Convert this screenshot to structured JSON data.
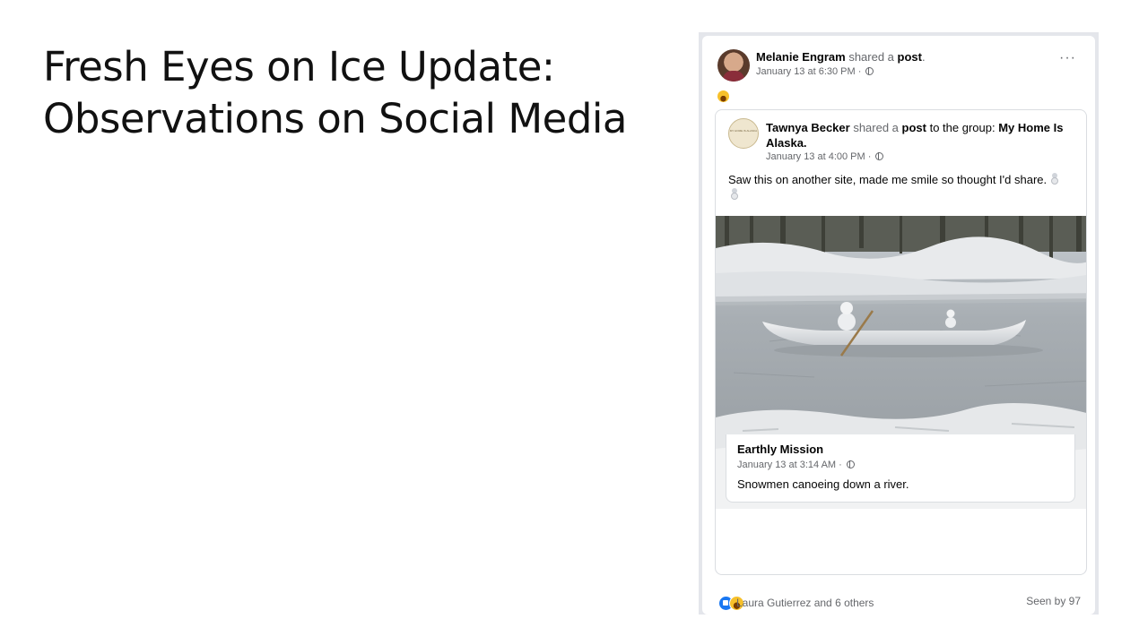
{
  "slide": {
    "title_line1": "Fresh Eyes on Ice Update:",
    "title_line2": "Observations on Social Media"
  },
  "post": {
    "poster_name": "Melanie Engram",
    "poster_action": " shared a ",
    "poster_object": "post",
    "poster_suffix": ".",
    "timestamp": "January 13 at 6:30 PM · ",
    "more_label": "···",
    "reaction_emoji": "laughing-emoji"
  },
  "shared_post": {
    "poster_name": "Tawnya Becker",
    "action1": " shared a ",
    "object": "post",
    "action2": " to the group: ",
    "group_name": "My Home Is Alaska.",
    "timestamp": "January 13 at 4:00 PM · ",
    "text": "Saw this on another site, made me smile so thought I'd share.",
    "logo_text": "MY HOME IS ALASKA"
  },
  "original": {
    "page_name": "Earthly Mission",
    "timestamp": "January 13 at 3:14 AM · ",
    "text": "Snowmen canoeing down a river."
  },
  "footer": {
    "reactions_text": "Laura Gutierrez and 6 others",
    "seen_text": "Seen by 97"
  },
  "colors": {
    "facebook_blue": "#1877f2",
    "secondary_text": "#65676b",
    "border": "#dadde1"
  }
}
